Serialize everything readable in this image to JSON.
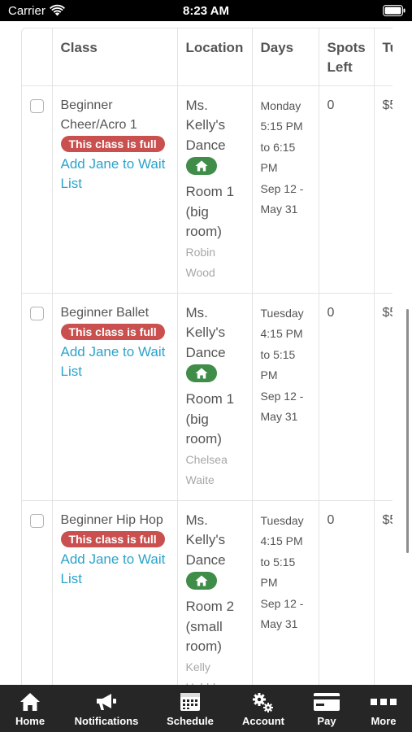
{
  "status_bar": {
    "carrier": "Carrier",
    "time": "8:23 AM"
  },
  "table": {
    "headers": [
      "Class",
      "Location",
      "Days",
      "Spots Left",
      "Tu"
    ],
    "rows": [
      {
        "class_name": "Beginner Cheer/Acro 1",
        "badge": "This class is full",
        "waitlist": "Add Jane to Wait List",
        "location": "Ms. Kelly's Dance",
        "room": "Room 1 (big room)",
        "instructor": "Robin Wood",
        "day": "Monday",
        "time": "5:15 PM to 6:15 PM",
        "dates": "Sep 12 - May 31",
        "spots": "0",
        "tuition": "$5"
      },
      {
        "class_name": "Beginner Ballet",
        "badge": "This class is full",
        "waitlist": "Add Jane to Wait List",
        "location": "Ms. Kelly's Dance",
        "room": "Room 1 (big room)",
        "instructor": "Chelsea Waite",
        "day": "Tuesday",
        "time": "4:15 PM to 5:15 PM",
        "dates": "Sep 12 - May 31",
        "spots": "0",
        "tuition": "$5"
      },
      {
        "class_name": "Beginner Hip Hop",
        "badge": "This class is full",
        "waitlist": "Add Jane to Wait List",
        "location": "Ms. Kelly's Dance",
        "room": "Room 2 (small room)",
        "instructor": "Kelly Hubble",
        "day": "Tuesday",
        "time": "4:15 PM to 5:15 PM",
        "dates": "Sep 12 - May 31",
        "spots": "0",
        "tuition": "$5"
      }
    ]
  },
  "tab_bar": {
    "items": [
      {
        "label": "Home",
        "icon": "home-icon"
      },
      {
        "label": "Notifications",
        "icon": "megaphone-icon"
      },
      {
        "label": "Schedule",
        "icon": "calendar-icon"
      },
      {
        "label": "Account",
        "icon": "gears-icon"
      },
      {
        "label": "Pay",
        "icon": "credit-card-icon"
      },
      {
        "label": "More",
        "icon": "more-icon"
      }
    ]
  },
  "colors": {
    "full_badge": "#c9504f",
    "location_badge": "#3f8d48",
    "link": "#2ba3cc",
    "tab_bar": "#262626"
  }
}
